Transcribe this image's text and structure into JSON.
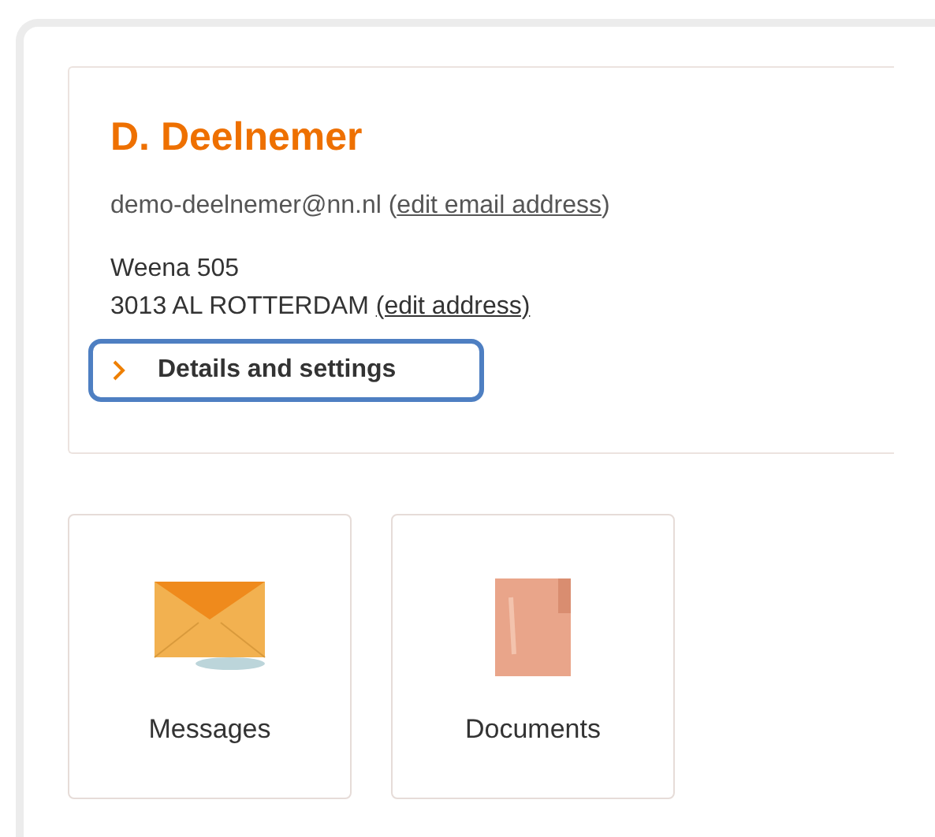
{
  "profile": {
    "name": "D. Deelnemer",
    "email_prefix": "demo-deelnemer@nn.nl (",
    "email_link": "edit email address",
    "email_suffix": ")",
    "address_line_1": "Weena 505",
    "address_line_2_prefix": "3013 AL ROTTERDAM ",
    "address_link": "(edit address)",
    "details_button": {
      "label": "Details and settings",
      "focused": true
    }
  },
  "tiles": [
    {
      "kind": "messages",
      "label": "Messages"
    },
    {
      "kind": "documents",
      "label": "Documents"
    }
  ]
}
